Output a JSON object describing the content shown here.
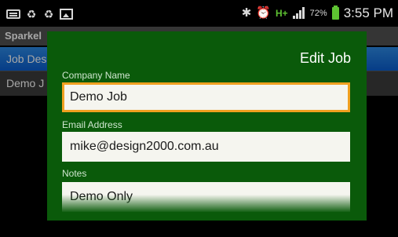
{
  "status_bar": {
    "icons_left": [
      "keyboard-icon",
      "recycle-icon",
      "recycle-icon",
      "gallery-icon"
    ],
    "icons_right": [
      "bluetooth-icon",
      "alarm-icon",
      "hplus-network-icon",
      "signal-icon"
    ],
    "network_type": "H+",
    "battery_percent": "72%",
    "battery_level": 0.72,
    "time": "3:55 PM"
  },
  "background_app": {
    "title": "Sparkel",
    "list_items": [
      {
        "label": "Job Des",
        "selected": true
      },
      {
        "label": "Demo J",
        "selected": false
      }
    ]
  },
  "dialog": {
    "title": "Edit Job",
    "colors": {
      "background": "#0a5a0a",
      "focus_border": "#f0a020"
    },
    "fields": {
      "company_name": {
        "label": "Company Name",
        "value": "Demo Job"
      },
      "email_address": {
        "label": "Email Address",
        "value": "mike@design2000.com.au"
      },
      "notes": {
        "label": "Notes",
        "value": "Demo Only"
      }
    }
  }
}
